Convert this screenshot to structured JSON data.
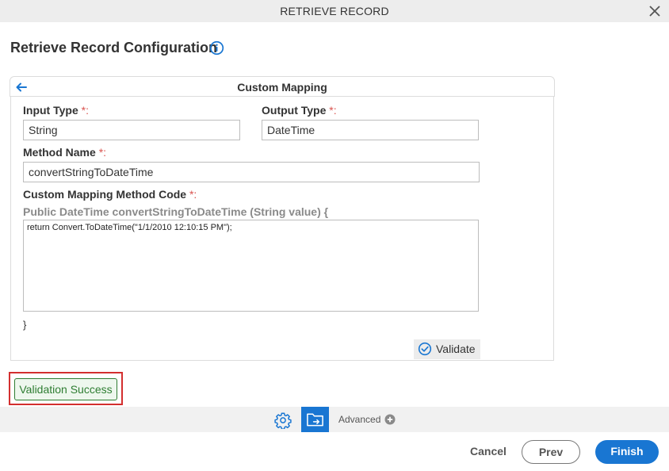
{
  "window": {
    "title": "RETRIEVE RECORD"
  },
  "page": {
    "title": "Retrieve Record Configuration"
  },
  "panel": {
    "title": "Custom Mapping"
  },
  "form": {
    "input_type_label": "Input Type",
    "output_type_label": "Output Type",
    "method_name_label": "Method Name",
    "code_label": "Custom Mapping Method Code",
    "required_marker": "*:",
    "input_type_value": "String",
    "output_type_value": "DateTime",
    "method_name_value": "convertStringToDateTime",
    "signature": "Public DateTime convertStringToDateTime (String value) {",
    "code_value": "return Convert.ToDateTime(\"1/1/2010 12:10:15 PM\");",
    "closing_brace": "}",
    "validate_label": "Validate"
  },
  "status": {
    "message": "Validation Success",
    "color": "#2e7d32"
  },
  "toolbar": {
    "advanced_label": "Advanced"
  },
  "footer": {
    "cancel_label": "Cancel",
    "prev_label": "Prev",
    "finish_label": "Finish"
  },
  "colors": {
    "accent": "#1976d2",
    "highlight_outline": "#d32f2f"
  }
}
